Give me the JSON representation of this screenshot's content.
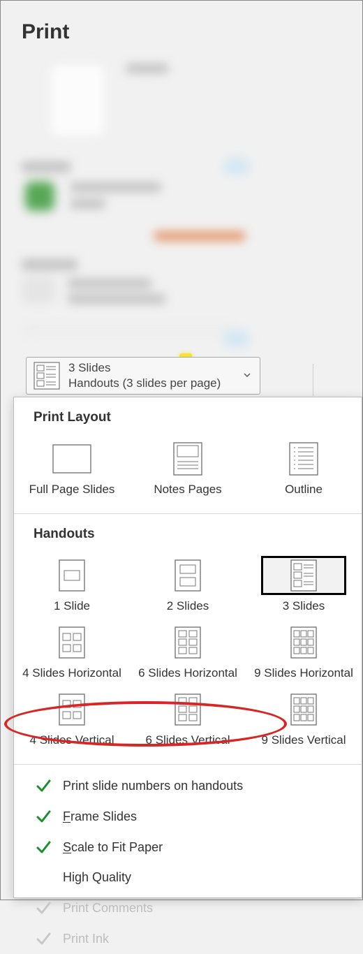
{
  "page": {
    "title": "Print"
  },
  "dropdown": {
    "line1": "3 Slides",
    "line2": "Handouts (3 slides per page)"
  },
  "sections": {
    "print_layout": {
      "header": "Print Layout",
      "items": [
        {
          "id": "full-page-slides",
          "label": "Full Page Slides"
        },
        {
          "id": "notes-pages",
          "label": "Notes Pages"
        },
        {
          "id": "outline",
          "label": "Outline"
        }
      ]
    },
    "handouts": {
      "header": "Handouts",
      "items": [
        {
          "id": "1-slide",
          "label": "1 Slide",
          "selected": false
        },
        {
          "id": "2-slides",
          "label": "2 Slides",
          "selected": false
        },
        {
          "id": "3-slides",
          "label": "3 Slides",
          "selected": true
        },
        {
          "id": "4h",
          "label": "4 Slides Horizontal"
        },
        {
          "id": "6h",
          "label": "6 Slides Horizontal"
        },
        {
          "id": "9h",
          "label": "9 Slides Horizontal"
        },
        {
          "id": "4v",
          "label": "4 Slides Vertical"
        },
        {
          "id": "6v",
          "label": "6 Slides Vertical"
        },
        {
          "id": "9v",
          "label": "9 Slides Vertical"
        }
      ]
    }
  },
  "options": [
    {
      "id": "print-slide-numbers",
      "label": "Print slide numbers on handouts",
      "checked": true,
      "enabled": true,
      "accel": null,
      "highlighted": true
    },
    {
      "id": "frame-slides",
      "label_pre": "",
      "accel": "F",
      "label_post": "rame Slides",
      "checked": true,
      "enabled": true
    },
    {
      "id": "scale-to-fit",
      "label_pre": "",
      "accel": "S",
      "label_post": "cale to Fit Paper",
      "checked": true,
      "enabled": true
    },
    {
      "id": "high-quality",
      "label": "High Quality",
      "checked": false,
      "enabled": true
    },
    {
      "id": "print-comments",
      "label": "Print Comments",
      "checked": true,
      "enabled": false
    },
    {
      "id": "print-ink",
      "label": "Print Ink",
      "checked": true,
      "enabled": false
    }
  ]
}
